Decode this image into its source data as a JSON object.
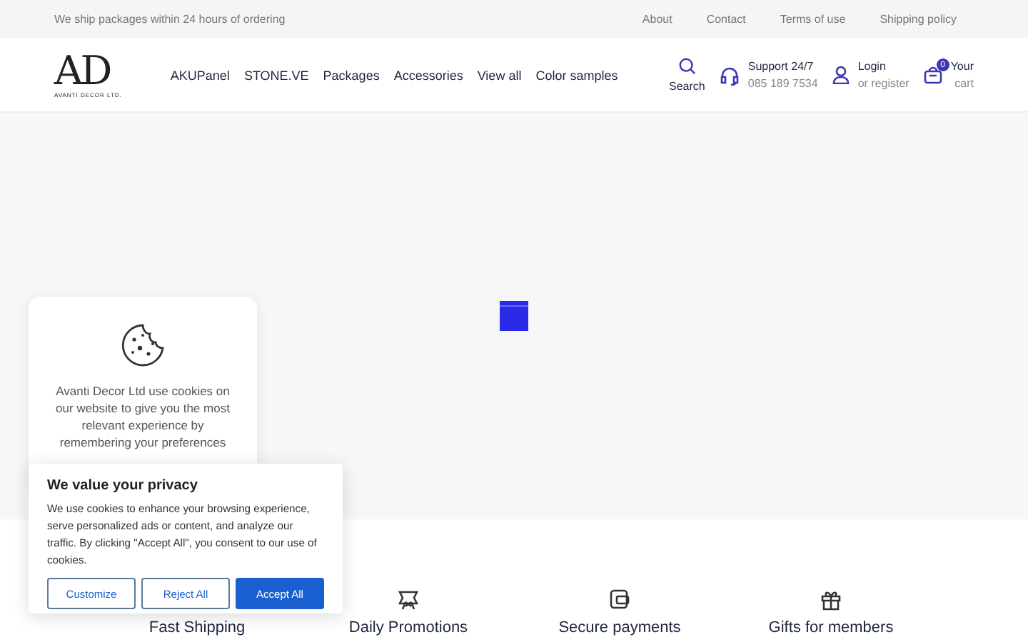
{
  "top_bar": {
    "notice": "We ship packages within 24 hours of ordering",
    "links": [
      "About",
      "Contact",
      "Terms of use",
      "Shipping policy"
    ]
  },
  "header": {
    "logo": {
      "mark": "AD",
      "tagline": "AVANTI DECOR LTD."
    },
    "nav": [
      "AKUPanel",
      "STONE.VE",
      "Packages",
      "Accessories",
      "View all",
      "Color samples"
    ],
    "search": "Search",
    "support": {
      "title": "Support 24/7",
      "phone": "085 189 7534"
    },
    "login": {
      "title": "Login",
      "subtitle": "or register"
    },
    "cart": {
      "count": "0",
      "title": "Your",
      "subtitle": "cart"
    }
  },
  "features": [
    {
      "label": "Fast Shipping",
      "kind": "covered"
    },
    {
      "label": "Daily Promotions",
      "kind": "promo"
    },
    {
      "label": "Secure payments",
      "kind": "wallet"
    },
    {
      "label": "Gifts for members",
      "kind": "gift"
    }
  ],
  "cookie_card": {
    "text": "Avanti Decor Ltd use cookies on our website to give you the most relevant experience by remembering your preferences"
  },
  "privacy_banner": {
    "title": "We value your privacy",
    "text": "We use cookies to enhance your browsing experience, serve personalized ads or content, and analyze our traffic. By clicking \"Accept All\", you consent to our use of cookies.",
    "buttons": [
      {
        "label": "Customize",
        "kind": "outline"
      },
      {
        "label": "Reject All",
        "kind": "outline"
      },
      {
        "label": "Accept All",
        "kind": "primary"
      }
    ]
  }
}
